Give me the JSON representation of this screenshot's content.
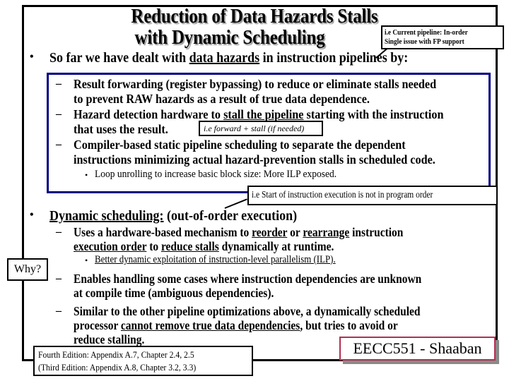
{
  "slide": {
    "title_line1": "Reduction of Data Hazards Stalls",
    "title_line2": "with Dynamic Scheduling",
    "callout_pipeline": {
      "line1": "i.e Current pipeline: In-order",
      "line2": "Single issue with FP support"
    },
    "intro": {
      "bullet": "•",
      "prefix": "So far we have dealt with ",
      "underlined": "data hazards",
      "suffix": " in instruction pipelines by:"
    },
    "methods": [
      {
        "dash": "–",
        "lines": [
          "Result forwarding (register bypassing) to reduce or eliminate stalls needed",
          "to prevent RAW hazards as a result of true data dependence."
        ]
      },
      {
        "dash": "–",
        "line1_prefix": "Hazard detection hardware to ",
        "line1_underlined": "stall the pipeline",
        "line1_suffix": " starting with the instruction",
        "line2": "that uses the result."
      },
      {
        "dash": "–",
        "lines": [
          "Compiler-based static pipeline scheduling to separate the dependent",
          "instructions minimizing actual hazard-prevention stalls in scheduled code."
        ],
        "sub_bullet": "Loop unrolling to increase basic block size:  More ILP exposed."
      }
    ],
    "callout_forward_stall": "i.e   forward  + stall (if needed)",
    "callout_out_of_order": "i.e  Start of instruction execution is not in program order",
    "dynamic": {
      "bullet": "•",
      "heading_underlined": "Dynamic scheduling:",
      "heading_suffix": "   (out-of-order execution)",
      "items": [
        {
          "dash": "–",
          "line1_a": "Uses a hardware-based mechanism  to ",
          "line1_u1": "reorder",
          "line1_b": " or ",
          "line1_u2": "rearrange",
          "line1_c": " instruction",
          "line2_u1": "execution order",
          "line2_a": " to ",
          "line2_u2": "reduce stalls",
          "line2_b": " dynamically at runtime.",
          "sub_bullet": "Better dynamic exploitation of instruction-level parallelism (ILP)."
        },
        {
          "dash": "–",
          "lines": [
            "Enables handling some cases where instruction dependencies are unknown",
            "at compile time (ambiguous dependencies)."
          ]
        },
        {
          "dash": "–",
          "line1": "Similar to the other pipeline optimizations above, a dynamically scheduled",
          "line2_a": "processor ",
          "line2_u": "cannot remove true data dependencies",
          "line2_b": ", but tries to avoid or",
          "line3": "reduce stalling."
        }
      ]
    },
    "why_label": "Why?",
    "reference": {
      "line1": "Fourth Edition: Appendix A.7, Chapter 2.4, 2.5",
      "line2": "(Third Edition: Appendix A.8,  Chapter 3.2,  3.3)"
    },
    "course_label": "EECC551 - Shaaban",
    "colors": {
      "blue_box_border": "#000080",
      "course_border": "#b03050",
      "title_shadow": "#9a9a9a"
    }
  }
}
